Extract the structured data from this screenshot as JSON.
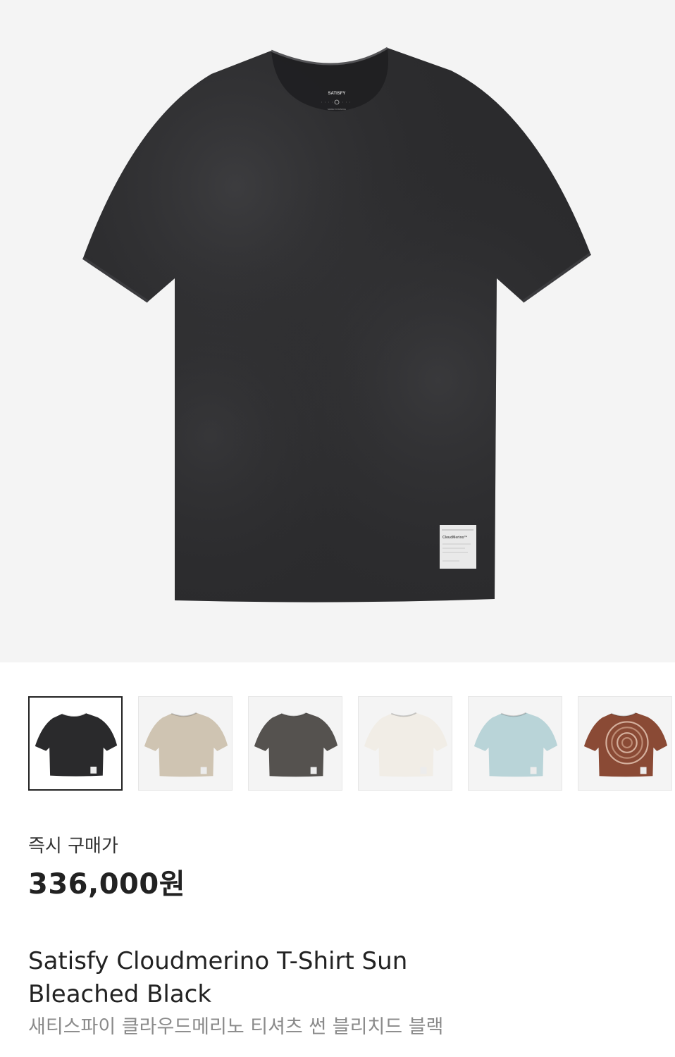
{
  "product": {
    "main_image": {
      "icon": "tshirt-image",
      "color": "#2b2b2d",
      "neck_label_brand": "SATISFY",
      "neck_label_sub": "MADE IN FRANCE",
      "hem_label_text": "CloudMerino™"
    },
    "variants": [
      {
        "name": "tshirt-thumbnail-black",
        "color": "#2a2a2c",
        "selected": true
      },
      {
        "name": "tshirt-thumbnail-beige",
        "color": "#cfc4b2",
        "selected": false
      },
      {
        "name": "tshirt-thumbnail-charcoal",
        "color": "#55524f",
        "selected": false
      },
      {
        "name": "tshirt-thumbnail-white",
        "color": "#f1ede6",
        "selected": false
      },
      {
        "name": "tshirt-thumbnail-lightblue",
        "color": "#b9d4d8",
        "selected": false
      },
      {
        "name": "tshirt-thumbnail-tiedye-brown",
        "color": "#8a4a35",
        "selected": false
      }
    ],
    "price_label": "즉시 구매가",
    "price": "336,000원",
    "title_en": "Satisfy Cloudmerino T-Shirt Sun Bleached Black",
    "title_ko": "새티스파이 클라우드메리노 티셔츠 썬 블리치드 블랙"
  }
}
